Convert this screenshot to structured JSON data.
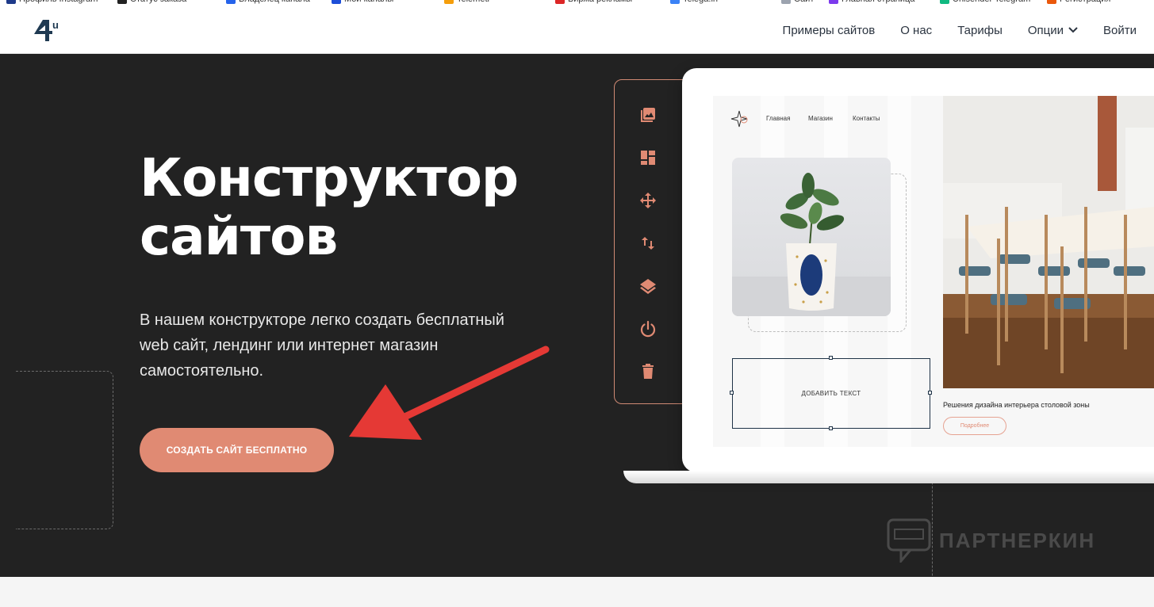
{
  "browser": {
    "bookmarks": [
      {
        "label": "Профиль Instagram",
        "color": "#1e3a8a"
      },
      {
        "label": "Статус заказа",
        "color": "#222222"
      },
      {
        "label": "Владелец канала",
        "color": "#2563eb"
      },
      {
        "label": "Мои каналы",
        "color": "#1d4ed8"
      },
      {
        "label": "Telemetr",
        "color": "#f59e0b"
      },
      {
        "label": "Биржа рекламы",
        "color": "#dc2626"
      },
      {
        "label": "Telega.in",
        "color": "#3b82f6"
      },
      {
        "label": "Сайт",
        "color": "#9ca3af"
      },
      {
        "label": "Главная страница",
        "color": "#7c3aed"
      },
      {
        "label": "Unisender Telegram",
        "color": "#10b981"
      },
      {
        "label": "Регистрация",
        "color": "#ea580c"
      }
    ]
  },
  "header": {
    "logo_text": "4u",
    "nav": {
      "examples": "Примеры сайтов",
      "about": "О нас",
      "pricing": "Тарифы",
      "options": "Опции",
      "login": "Войти"
    }
  },
  "hero": {
    "title_line1": "Конструктор",
    "title_line2": "сайтов",
    "description": "В нашем конструкторе легко создать бесплатный web сайт, лендинг или интернет магазин самостоятельно.",
    "cta": "СОЗДАТЬ САЙТ БЕСПЛАТНО"
  },
  "toolbar": {
    "icons": [
      "image-icon",
      "layout-icon",
      "move-icon",
      "swap-vertical-icon",
      "layers-icon",
      "power-icon",
      "trash-icon"
    ]
  },
  "mockup": {
    "nav": [
      "Главная",
      "Магазин",
      "Контакты"
    ],
    "add_text": "ДОБАВИТЬ ТЕКСТ",
    "caption": "Решения дизайна интерьера столовой зоны",
    "more_button": "Подробнее"
  },
  "watermark": "ПАРТНЕРКИН",
  "colors": {
    "accent": "#e08a73",
    "hero_bg": "#222222",
    "nav_text": "#2b3440",
    "logo": "#1f3a52",
    "arrow": "#e53935"
  }
}
